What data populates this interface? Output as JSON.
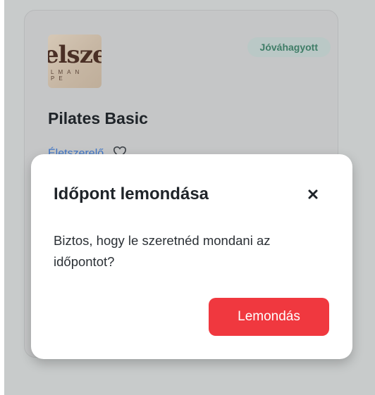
{
  "card": {
    "logo_text": "elszer",
    "logo_subtext": "LMAN PE",
    "status_badge": "Jóváhagyott",
    "title": "Pilates Basic",
    "studio_link": "Életszerelő"
  },
  "modal": {
    "title": "Időpont lemondása",
    "body": "Biztos, hogy le szeretnéd mondani az időpontot?",
    "confirm_label": "Lemondás",
    "close_icon": "close-icon"
  },
  "colors": {
    "danger": "#f0383f",
    "badge_text": "#3f7d67",
    "link": "#3d74c7"
  }
}
